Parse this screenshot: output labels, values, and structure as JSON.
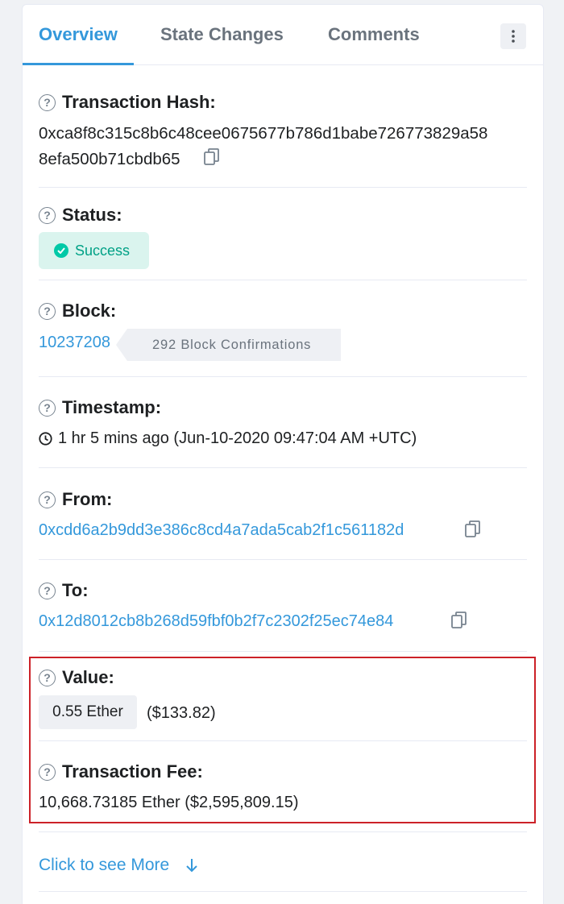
{
  "tabs": {
    "overview": "Overview",
    "state_changes": "State Changes",
    "comments": "Comments"
  },
  "help_icon_glyph": "?",
  "transaction_hash": {
    "label": "Transaction Hash:",
    "line1": "0xca8f8c315c8b6c48cee0675677b786d1babe726773829a58",
    "line2": "8efa500b71cbdb65"
  },
  "status": {
    "label": "Status:",
    "value": "Success",
    "color": "#00a186"
  },
  "block": {
    "label": "Block:",
    "number": "10237208",
    "confirmations": "292 Block Confirmations"
  },
  "timestamp": {
    "label": "Timestamp:",
    "value": "1 hr 5 mins ago (Jun-10-2020 09:47:04 AM +UTC)"
  },
  "from": {
    "label": "From:",
    "address": "0xcdd6a2b9dd3e386c8cd4a7ada5cab2f1c561182d"
  },
  "to": {
    "label": "To:",
    "address": "0x12d8012cb8b268d59fbf0b2f7c2302f25ec74e84"
  },
  "value": {
    "label": "Value:",
    "amount": "0.55 Ether",
    "usd": "($133.82)"
  },
  "transaction_fee": {
    "label": "Transaction Fee:",
    "value": "10,668.73185 Ether ($2,595,809.15)"
  },
  "see_more": {
    "label": "Click to see More"
  },
  "colors": {
    "accent": "#3498db",
    "highlight_border": "#cc2128",
    "success": "#00c9a7"
  },
  "icons": [
    "more-vertical-icon",
    "help-icon",
    "copy-icon",
    "check-circle-icon",
    "clock-icon",
    "arrow-down-icon"
  ]
}
